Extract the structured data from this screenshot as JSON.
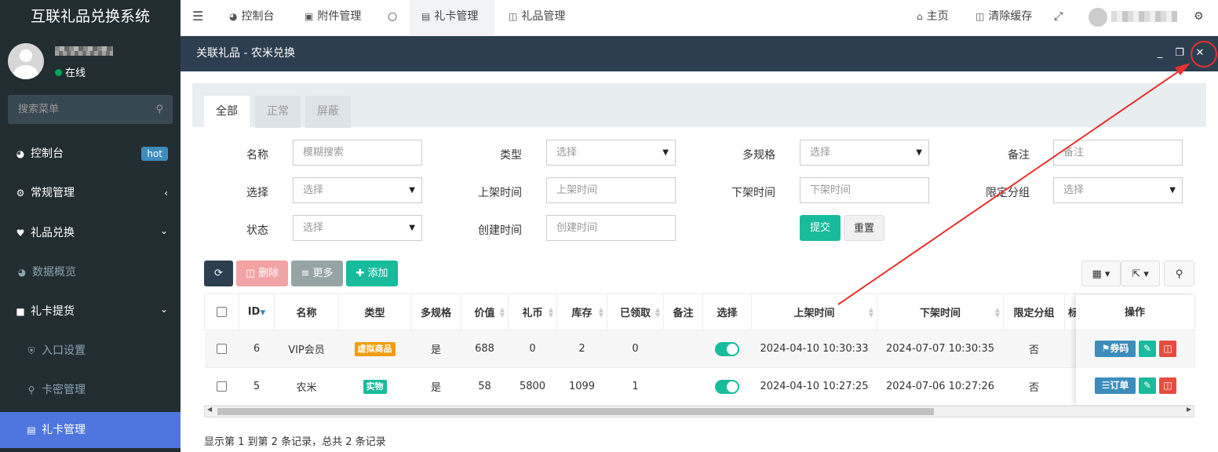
{
  "sidebar": {
    "logo": "互联礼品兑换系统",
    "status": "在线",
    "search_placeholder": "搜索菜单",
    "items": [
      {
        "label": "控制台",
        "icon": "dashboard-icon",
        "badge": "hot"
      },
      {
        "label": "常规管理",
        "icon": "cogs-icon",
        "arrow": "‹"
      },
      {
        "label": "礼品兑换",
        "icon": "heart-icon",
        "arrow": "⌄"
      },
      {
        "label": "数据概览",
        "icon": "dashboard-icon"
      },
      {
        "label": "礼卡提货",
        "icon": "book-icon",
        "arrow": "⌄"
      },
      {
        "label": "入口设置",
        "icon": "shield-icon"
      },
      {
        "label": "卡密管理",
        "icon": "key-icon"
      },
      {
        "label": "礼卡管理",
        "icon": "id-card-icon"
      }
    ]
  },
  "topnav": {
    "tabs": [
      {
        "label": "控制台",
        "icon": "dashboard-icon"
      },
      {
        "label": "附件管理",
        "icon": "file-image-icon"
      },
      {
        "label": "",
        "icon": "circle-icon"
      },
      {
        "label": "礼卡管理",
        "icon": "id-card-icon"
      },
      {
        "label": "礼品管理",
        "icon": "gift-icon"
      }
    ],
    "home": "主页",
    "clear_cache": "清除缓存"
  },
  "dialog": {
    "title": "关联礼品 - 农米兑换",
    "tabs": [
      "全部",
      "正常",
      "屏蔽"
    ],
    "filters": {
      "name_label": "名称",
      "name_placeholder": "模糊搜索",
      "type_label": "类型",
      "type_value": "选择",
      "spec_label": "多规格",
      "spec_value": "选择",
      "remark_label": "备注",
      "remark_placeholder": "备注",
      "select_label": "选择",
      "select_value": "选择",
      "on_label": "上架时间",
      "on_placeholder": "上架时间",
      "off_label": "下架时间",
      "off_placeholder": "下架时间",
      "group_label": "限定分组",
      "group_value": "选择",
      "status_label": "状态",
      "status_value": "选择",
      "created_label": "创建时间",
      "created_placeholder": "创建时间",
      "submit": "提交",
      "reset": "重置"
    },
    "toolbar": {
      "delete": "删除",
      "more": "更多",
      "add": "添加"
    },
    "table": {
      "headers": [
        "ID",
        "名称",
        "类型",
        "多规格",
        "价值",
        "礼币",
        "库存",
        "已领取",
        "备注",
        "选择",
        "上架时间",
        "下架时间",
        "限定分组",
        "标",
        "操作"
      ],
      "rows": [
        {
          "id": "6",
          "name": "VIP会员",
          "type": "虚拟商品",
          "type_color": "#f39c12",
          "spec": "是",
          "value": "688",
          "coin": "0",
          "stock": "2",
          "received": "0",
          "remark": "",
          "on": "2024-04-10 10:30:33",
          "off": "2024-07-07 10:30:35",
          "group": "否",
          "op": "券码"
        },
        {
          "id": "5",
          "name": "农米",
          "type": "实物",
          "type_color": "#18bc9c",
          "spec": "是",
          "value": "58",
          "coin": "5800",
          "stock": "1099",
          "received": "1",
          "remark": "",
          "on": "2024-04-10 10:27:25",
          "off": "2024-07-06 10:27:26",
          "group": "否",
          "op": "订单"
        }
      ]
    },
    "footer": "显示第 1 到第 2 条记录，总共 2 条记录"
  },
  "colors": {
    "sidebar": "#222d32",
    "active": "#4f76de",
    "header": "#2c3e50",
    "success": "#18bc9c",
    "danger": "#e74c3c",
    "primary": "#3c8dbc"
  }
}
